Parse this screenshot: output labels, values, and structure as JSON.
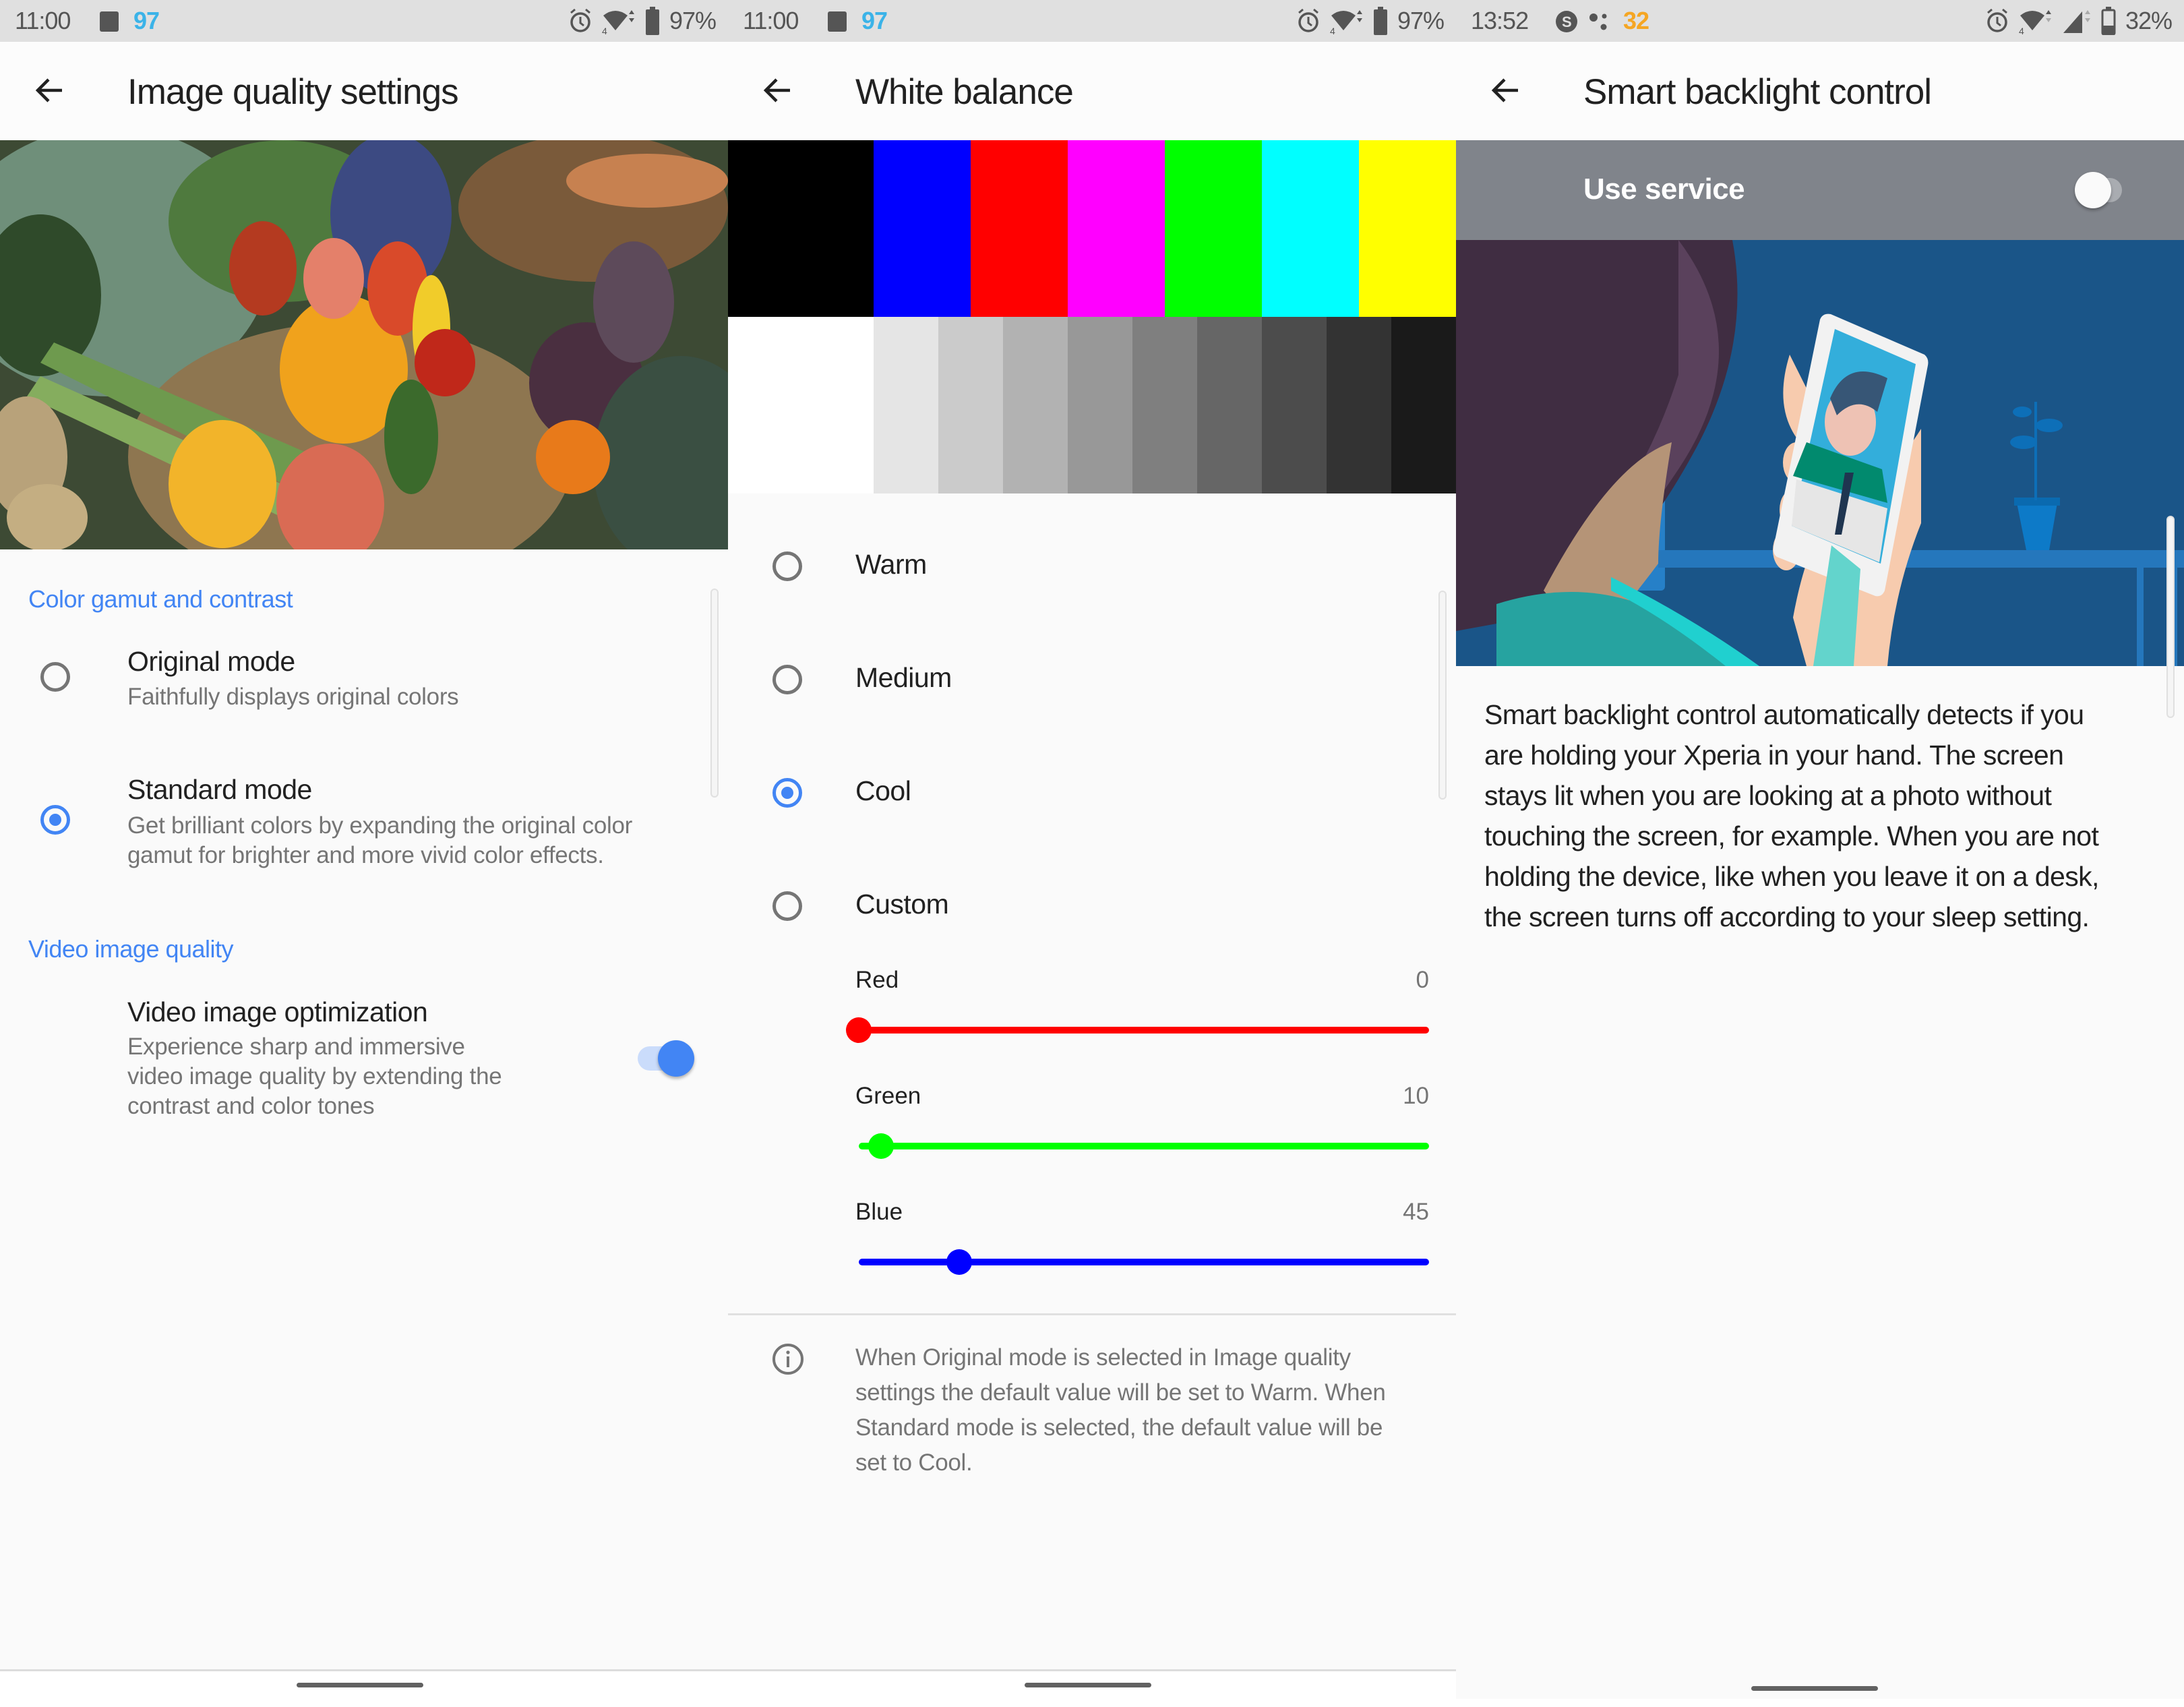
{
  "panels": [
    {
      "status_bar": {
        "time": "11:00",
        "notification_count": "97",
        "notification_count_color": "#3bb3e8",
        "battery": "97%",
        "icons": [
          "alarm-icon",
          "wifi-icon",
          "battery-icon"
        ]
      },
      "title": "Image quality settings",
      "back_icon": "arrow-back-icon",
      "photo_alt": "Basket of fresh vegetables",
      "sections": [
        {
          "header": "Color gamut and contrast",
          "options": [
            {
              "title": "Original mode",
              "subtitle": "Faithfully displays original colors",
              "selected": false
            },
            {
              "title": "Standard mode",
              "subtitle_lines": [
                "Get brilliant colors by expanding the original color",
                "gamut for brighter and more vivid color effects."
              ],
              "selected": true
            }
          ]
        },
        {
          "header": "Video image quality",
          "options": [
            {
              "title": "Video image optimization",
              "subtitle_lines": [
                "Experience sharp and immersive",
                "video image quality by extending the",
                "contrast and color tones"
              ],
              "toggle_on": true
            }
          ]
        }
      ]
    },
    {
      "status_bar": {
        "time": "11:00",
        "notification_count": "97",
        "notification_count_color": "#3bb3e8",
        "battery": "97%",
        "icons": [
          "alarm-icon",
          "wifi-icon",
          "battery-icon"
        ]
      },
      "title": "White balance",
      "back_icon": "arrow-back-icon",
      "color_bars": [
        "#000000",
        "#0000ff",
        "#ff0000",
        "#ff00ff",
        "#00ff00",
        "#00ffff",
        "#ffff00"
      ],
      "gray_bars": [
        "#ffffff",
        "#e5e5e5",
        "#cbcbcb",
        "#b2b2b2",
        "#989898",
        "#7f7f7f",
        "#666666",
        "#4c4c4c",
        "#333333",
        "#1a1a1a"
      ],
      "options": [
        {
          "label": "Warm",
          "selected": false
        },
        {
          "label": "Medium",
          "selected": false
        },
        {
          "label": "Cool",
          "selected": true
        },
        {
          "label": "Custom",
          "selected": false
        }
      ],
      "sliders": [
        {
          "label": "Red",
          "value": "0",
          "fraction": 0.0,
          "color": "#ff0000"
        },
        {
          "label": "Green",
          "value": "10",
          "fraction": 0.039,
          "color": "#00ff00"
        },
        {
          "label": "Blue",
          "value": "45",
          "fraction": 0.176,
          "color": "#0000ff"
        }
      ],
      "slider_max": 255,
      "info_icon": "info-icon",
      "info_lines": [
        "When Original mode is selected in Image quality",
        "settings the default value will be set to Warm. When",
        "Standard mode is selected, the default value will be",
        "set to Cool."
      ]
    },
    {
      "status_bar": {
        "time": "13:52",
        "notification_count": "32",
        "notification_count_color": "#f5a623",
        "battery": "32%",
        "icons": [
          "skype-icon",
          "assistant-icon",
          "alarm-icon",
          "wifi-icon",
          "cellular-signal-icon",
          "battery-icon"
        ]
      },
      "title": "Smart backlight control",
      "back_icon": "arrow-back-icon",
      "use_service": {
        "label": "Use service",
        "toggle_on": false
      },
      "illustration_alt": "Person holding phone with video call",
      "description_lines": [
        "Smart backlight control automatically detects if you",
        "are holding your Xperia in your hand. The screen",
        "stays lit when you are looking at a photo without",
        "touching the screen, for example. When you are not",
        "holding the device, like when you leave it on a desk,",
        "the screen turns off according to your sleep setting."
      ]
    }
  ],
  "accent_color": "#4285f4"
}
